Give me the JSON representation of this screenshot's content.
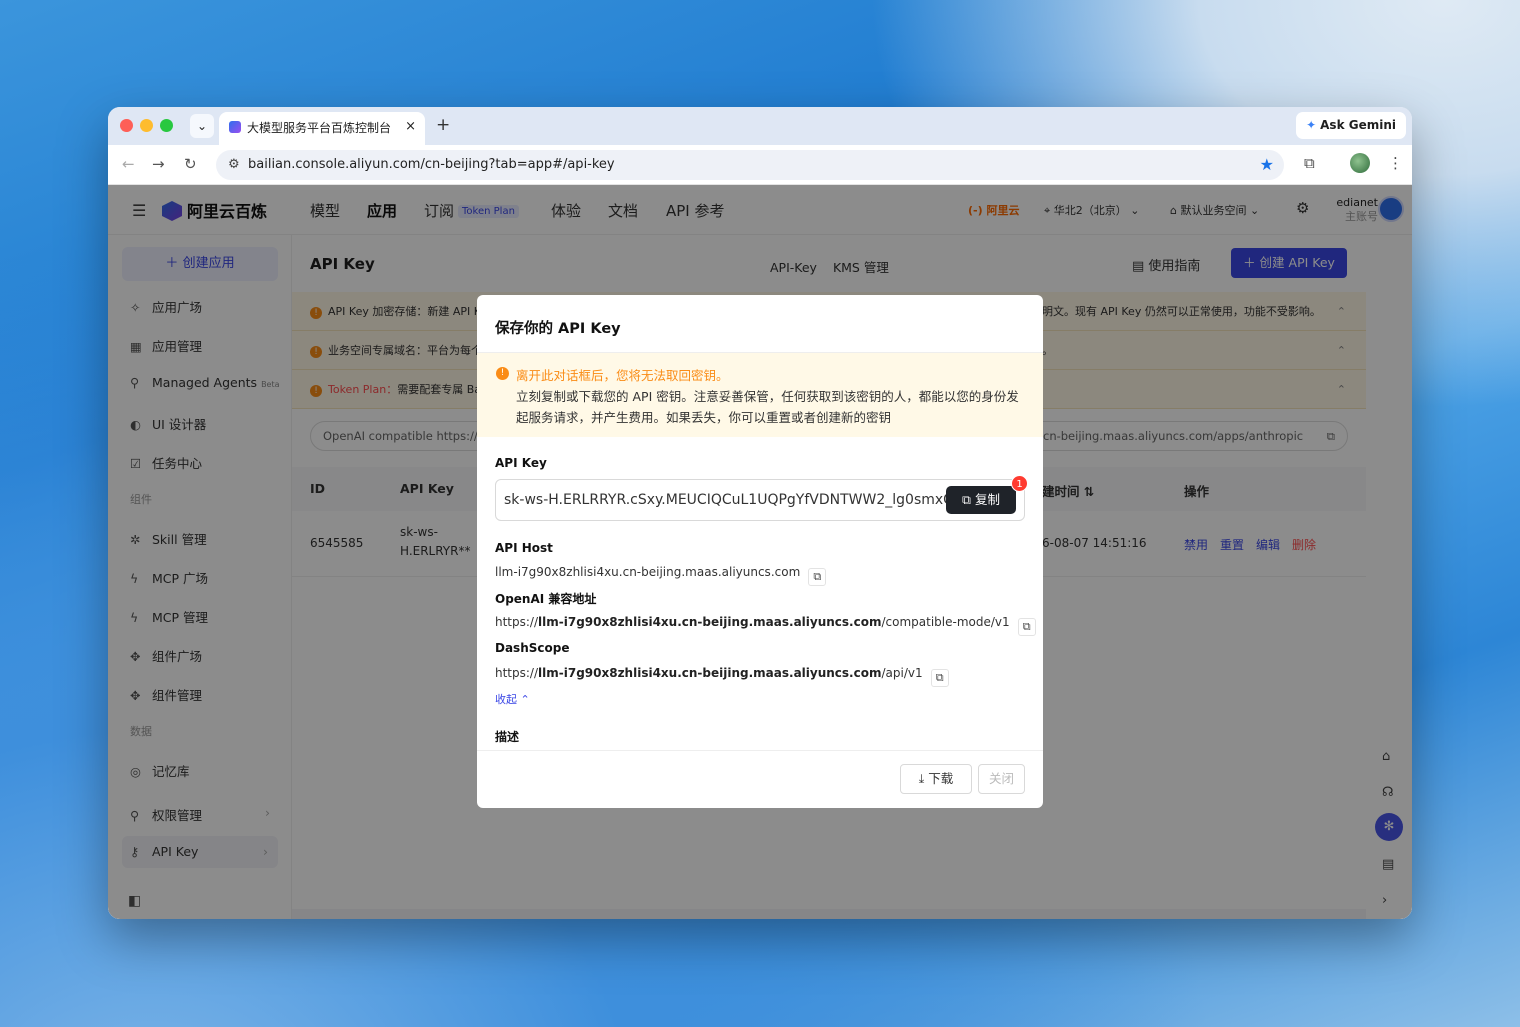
{
  "browser": {
    "tab_title": "大模型服务平台百炼控制台",
    "tab_close": "×",
    "new_tab": "+",
    "gemini_label": "Ask Gemini",
    "url": "bailian.console.aliyun.com/cn-beijing?tab=app#/api-key"
  },
  "header": {
    "brand": "阿里云百炼",
    "nav": [
      "模型",
      "应用",
      "订阅",
      "体验",
      "文档",
      "API 参考"
    ],
    "token_plan_badge": "Token Plan",
    "aliyun_logo": "(-) 阿里云",
    "region": "华北2（北京）",
    "workspace": "默认业务空间",
    "username": "edianet",
    "user_role": "主账号"
  },
  "sidebar": {
    "create_app": "创建应用",
    "items": [
      {
        "label": "应用广场",
        "icon": "sparkle-icon"
      },
      {
        "label": "应用管理",
        "icon": "grid-icon"
      },
      {
        "label": "Managed Agents",
        "icon": "agent-icon",
        "badge": "Beta"
      },
      {
        "label": "UI 设计器",
        "icon": "palette-icon"
      },
      {
        "label": "任务中心",
        "icon": "task-icon"
      }
    ],
    "group_components": "组件",
    "component_items": [
      {
        "label": "Skill 管理"
      },
      {
        "label": "MCP 广场"
      },
      {
        "label": "MCP 管理"
      },
      {
        "label": "组件广场"
      },
      {
        "label": "组件管理"
      }
    ],
    "group_data": "数据",
    "data_items": [
      {
        "label": "记忆库"
      }
    ],
    "permission": "权限管理",
    "api_key": "API Key"
  },
  "page": {
    "title": "API Key",
    "segments": [
      "API-Key",
      "KMS 管理"
    ],
    "guide": "使用指南",
    "create_btn": "创建 API Key",
    "notices": [
      {
        "left": "API Key 加密存储：新建 API Ke",
        "right": "明文。现有 API Key 仍然可以正常使用，功能不受影响。"
      },
      {
        "left": "业务空间专属域名：平台为每个",
        "right": "。"
      },
      {
        "left_red": "Token Plan：",
        "left": "需要配套专属 Bas",
        "right": ""
      }
    ],
    "endpoint_left": "OpenAI compatible   https://llm-",
    "endpoint_right": "cn-beijing.maas.aliyuncs.com/apps/anthropic",
    "table_headers": {
      "id": "ID",
      "key": "API Key",
      "created": "建时间  ⇅",
      "ops": "操作"
    },
    "row": {
      "id": "6545585",
      "key_line1": "sk-ws-",
      "key_line2": "H.ERLRYR**",
      "created": "6-08-07 14:51:16",
      "ops": [
        "禁用",
        "重置",
        "编辑",
        "删除"
      ]
    }
  },
  "modal": {
    "title": "保存你的 API Key",
    "warn_head": "离开此对话框后，您将无法取回密钥。",
    "warn_line1": "立刻复制或下载您的 API 密钥。注意妥善保管，任何获取到该密钥的人，都能以您的身份发",
    "warn_line2": "起服务请求，并产生费用。如果丢失，你可以重置或者创建新的密钥",
    "key_label": "API Key",
    "key_value": "sk-ws-H.ERLRRYR.cSxy.MEUCIQCuL1UQPgYfVDNTWW2_lg0smxGt",
    "copy_label": "复制",
    "badge_count": "1",
    "host_label": "API Host",
    "host_value": "llm-i7g90x8zhlisi4xu.cn-beijing.maas.aliyuncs.com",
    "openai_label": "OpenAI 兼容地址",
    "openai_prefix": "https://",
    "openai_host": "llm-i7g90x8zhlisi4xu.cn-beijing.maas.aliyuncs.com",
    "openai_suffix": "/compatible-mode/v1",
    "dash_label": "DashScope",
    "dash_prefix": "https://",
    "dash_host": "llm-i7g90x8zhlisi4xu.cn-beijing.maas.aliyuncs.com",
    "dash_suffix": "/api/v1",
    "fold_label": "收起",
    "desc_label": "描述",
    "download": "下载",
    "close": "关闭"
  },
  "colors": {
    "accent": "#3b47e6",
    "warn": "#fa8c16",
    "danger": "#ff4d4f"
  }
}
